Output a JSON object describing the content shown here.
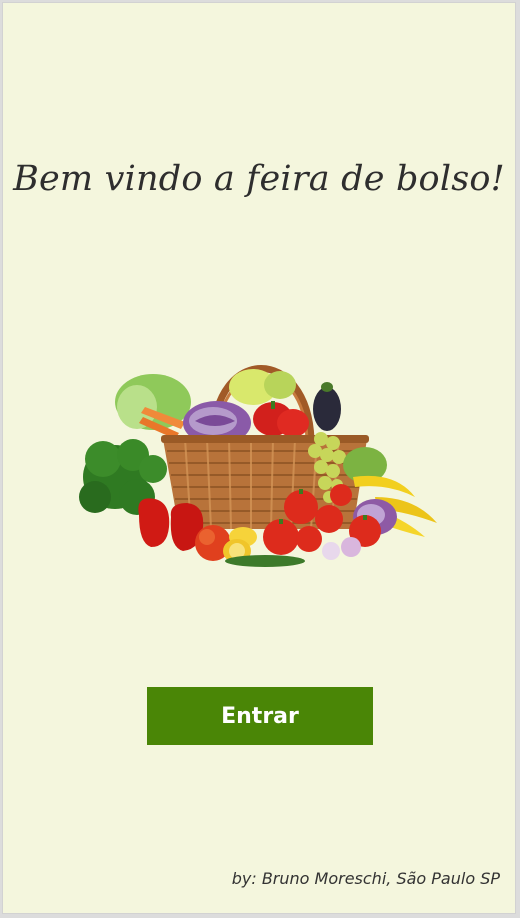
{
  "welcome": {
    "title": "Bem vindo a feira de bolso!"
  },
  "hero_image": {
    "icon": "vegetable-basket-image"
  },
  "actions": {
    "enter_label": "Entrar",
    "enter_color": "#4a8606"
  },
  "footer": {
    "credit": "by: Bruno Moreschi, São Paulo SP"
  },
  "theme": {
    "background": "#f4f6dd"
  }
}
